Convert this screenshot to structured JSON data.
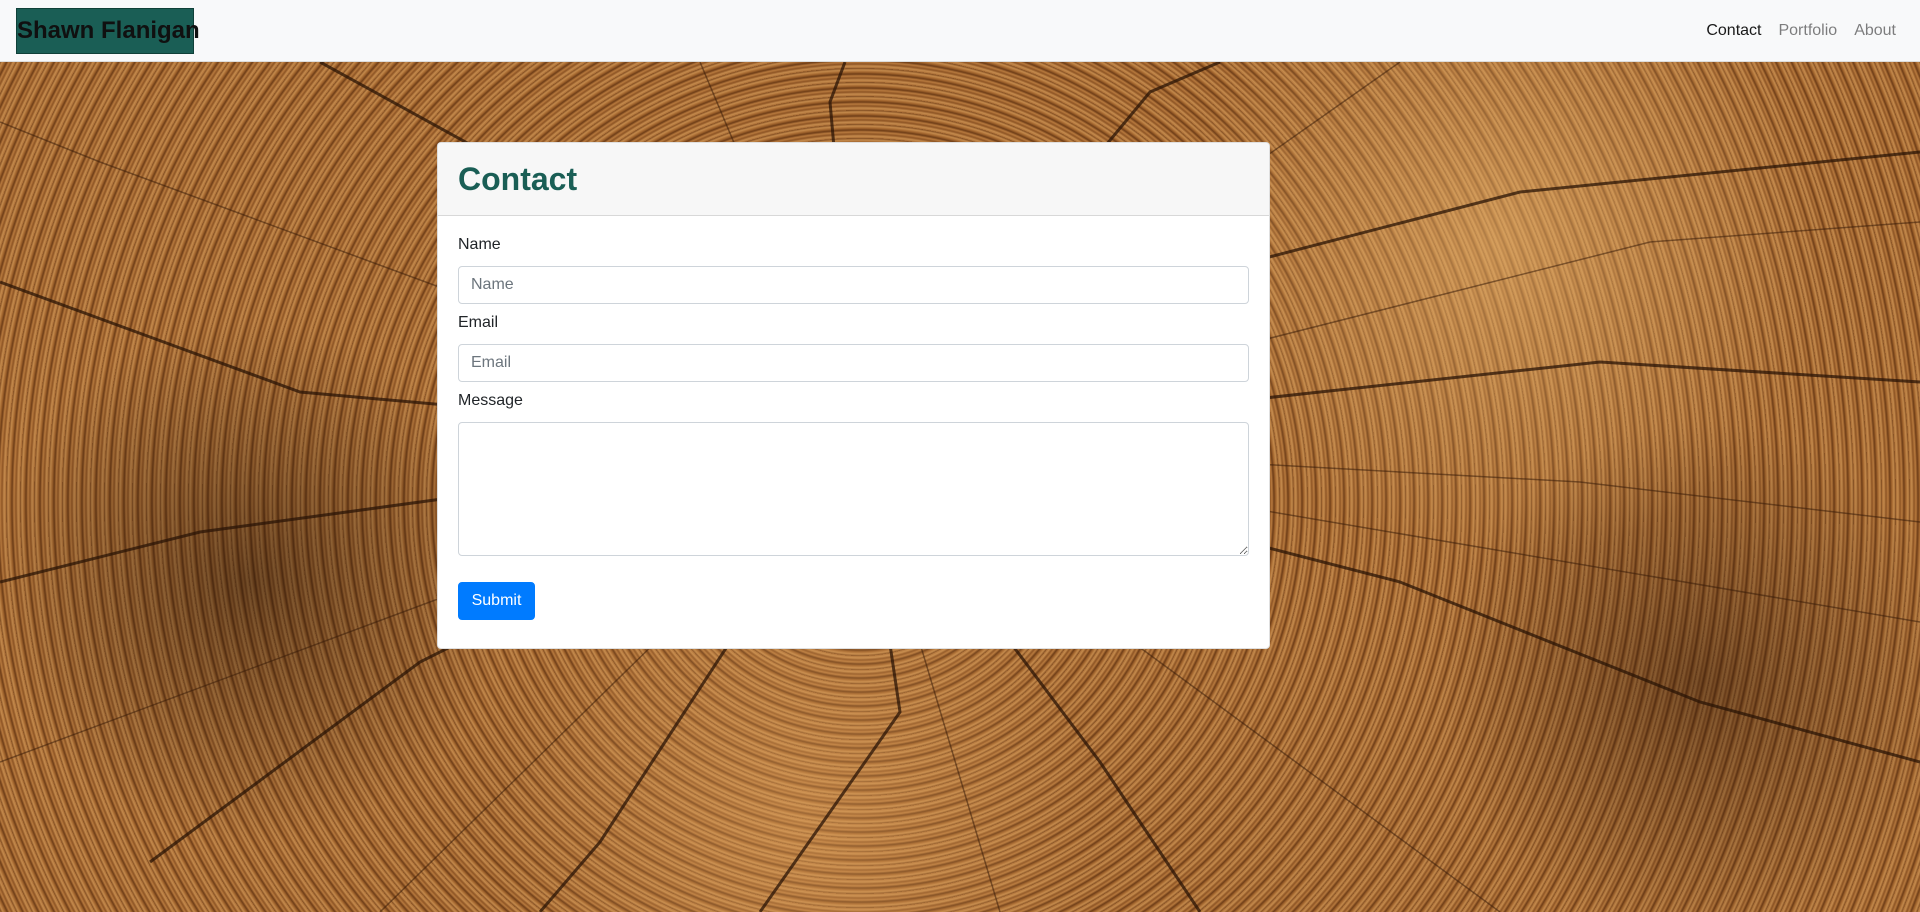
{
  "navbar": {
    "brand": "Shawn Flanigan",
    "links": [
      {
        "label": "Contact",
        "active": true
      },
      {
        "label": "Portfolio",
        "active": false
      },
      {
        "label": "About",
        "active": false
      }
    ]
  },
  "contact_card": {
    "title": "Contact",
    "fields": {
      "name": {
        "label": "Name",
        "placeholder": "Name",
        "value": ""
      },
      "email": {
        "label": "Email",
        "placeholder": "Email",
        "value": ""
      },
      "message": {
        "label": "Message",
        "value": ""
      }
    },
    "submit_label": "Submit"
  },
  "colors": {
    "brand_accent": "#1a5e55",
    "primary_button": "#007bff",
    "navbar_bg": "#f8f9fa"
  },
  "background": {
    "description_icon": "wood-grain-texture"
  }
}
